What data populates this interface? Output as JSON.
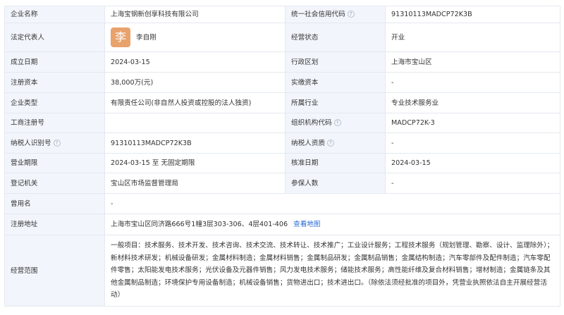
{
  "rows": {
    "company_name": {
      "label": "企业名称",
      "value": "上海宝钢新创享科技有限公司"
    },
    "credit_code": {
      "label": "统一社会信用代码",
      "value": "91310113MADCP72K3B"
    },
    "legal_rep": {
      "label": "法定代表人",
      "avatar_char": "李",
      "name": "李自刚"
    },
    "status": {
      "label": "经营状态",
      "value": "开业"
    },
    "founded": {
      "label": "成立日期",
      "value": "2024-03-15"
    },
    "district": {
      "label": "行政区划",
      "value": "上海市宝山区"
    },
    "reg_capital": {
      "label": "注册资本",
      "value": "38,000万(元)"
    },
    "paid_capital": {
      "label": "实缴资本",
      "value": "-"
    },
    "company_type": {
      "label": "企业类型",
      "value": "有限责任公司(非自然人投资或控股的法人独资)"
    },
    "industry": {
      "label": "所属行业",
      "value": "专业技术服务业"
    },
    "biz_reg_no": {
      "label": "工商注册号",
      "value": ""
    },
    "org_code": {
      "label": "组织机构代码",
      "value": "MADCP72K-3"
    },
    "taxpayer_id": {
      "label": "纳税人识别号",
      "value": "91310113MADCP72K3B"
    },
    "taxpayer_qual": {
      "label": "纳税人资质",
      "value": "-"
    },
    "biz_term": {
      "label": "营业期限",
      "value": "2024-03-15 至 无固定期限"
    },
    "approval_date": {
      "label": "核准日期",
      "value": "2024-03-15"
    },
    "reg_authority": {
      "label": "登记机关",
      "value": "宝山区市场监督管理局"
    },
    "insured": {
      "label": "参保人数",
      "value": "-"
    },
    "former_name": {
      "label": "曾用名",
      "value": "-"
    },
    "address": {
      "label": "注册地址",
      "value": "上海市宝山区同济路666号1幢3层303-306、4层401-406",
      "map_link": "查看地图"
    },
    "scope": {
      "label": "经营范围",
      "value": "一般项目：技术服务、技术开发、技术咨询、技术交流、技术转让、技术推广；工业设计服务；工程技术服务（规划管理、勘察、设计、监理除外）；新材料技术研发；机械设备研发；金属材料制造；金属材料销售；金属制品研发；金属制品销售；金属结构制造；汽车零部件及配件制造；汽车零配件零售；太阳能发电技术服务；光伏设备及元器件销售；风力发电技术服务；储能技术服务；高性能纤维及复合材料销售；增材制造；金属链条及其他金属制品制造；环境保护专用设备制造；机械设备销售；货物进出口；技术进出口。（除依法须经批准的项目外，凭营业执照依法自主开展经营活动）"
    }
  },
  "icons": {
    "help": "question-circle-icon"
  },
  "colors": {
    "label_bg": "#f2f6fc",
    "border": "#e4e8ef",
    "link": "#2a6bd6",
    "avatar_bg": "#e8a26c"
  }
}
